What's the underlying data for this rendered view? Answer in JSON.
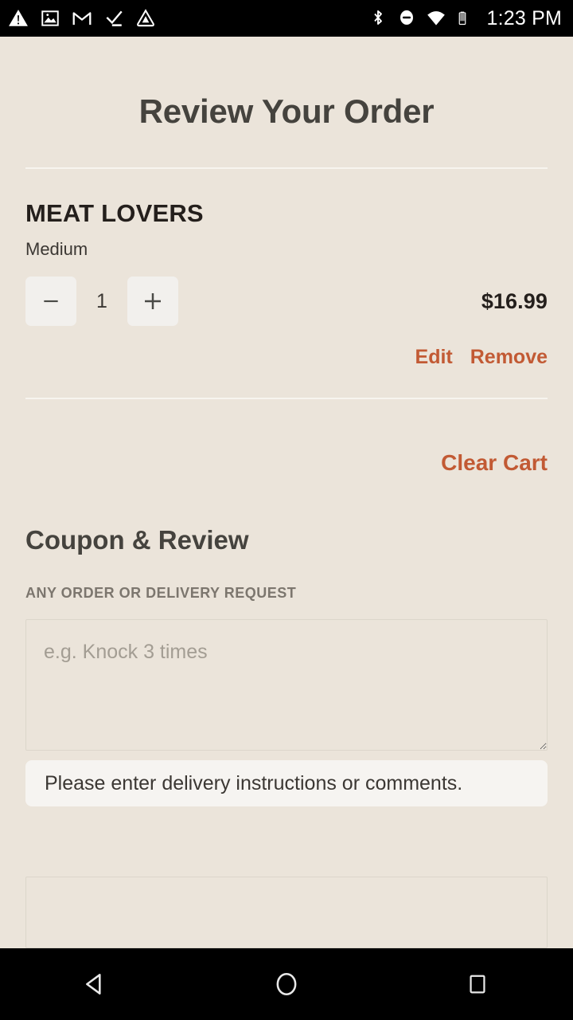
{
  "status_bar": {
    "left_icons": [
      {
        "name": "warning-triangle-icon"
      },
      {
        "name": "image-icon"
      },
      {
        "name": "gmail-icon"
      },
      {
        "name": "checkmark-icon"
      },
      {
        "name": "drive-triangle-icon"
      }
    ],
    "right_icons": [
      {
        "name": "bluetooth-icon"
      },
      {
        "name": "do-not-disturb-icon"
      },
      {
        "name": "wifi-icon"
      },
      {
        "name": "battery-icon"
      }
    ],
    "time": "1:23 PM"
  },
  "header": {
    "title": "Review Your Order"
  },
  "cart": {
    "item": {
      "name": "MEAT LOVERS",
      "variant": "Medium",
      "quantity": "1",
      "price": "$16.99",
      "decrement_label": "−",
      "increment_label": "+",
      "edit_label": "Edit",
      "remove_label": "Remove"
    },
    "clear_cart_label": "Clear Cart"
  },
  "coupon_review": {
    "heading": "Coupon & Review",
    "request_label": "ANY ORDER OR DELIVERY REQUEST",
    "request_value": "",
    "request_placeholder": "e.g. Knock 3 times",
    "helper_message": "Please enter delivery instructions or comments.",
    "coupon_value": "",
    "coupon_placeholder": ""
  },
  "nav_bar": {
    "back_label": "back-button",
    "home_label": "home-button",
    "recents_label": "recents-button"
  },
  "colors": {
    "page_background": "#ebe4da",
    "accent_orange": "#c25a34",
    "text_dark": "#241f1c",
    "text_heading": "#45433e",
    "text_muted": "#7c766e",
    "stepper_background": "#f2f0ed",
    "helper_background": "#f6f4f1",
    "divider": "#f7f4ef"
  }
}
